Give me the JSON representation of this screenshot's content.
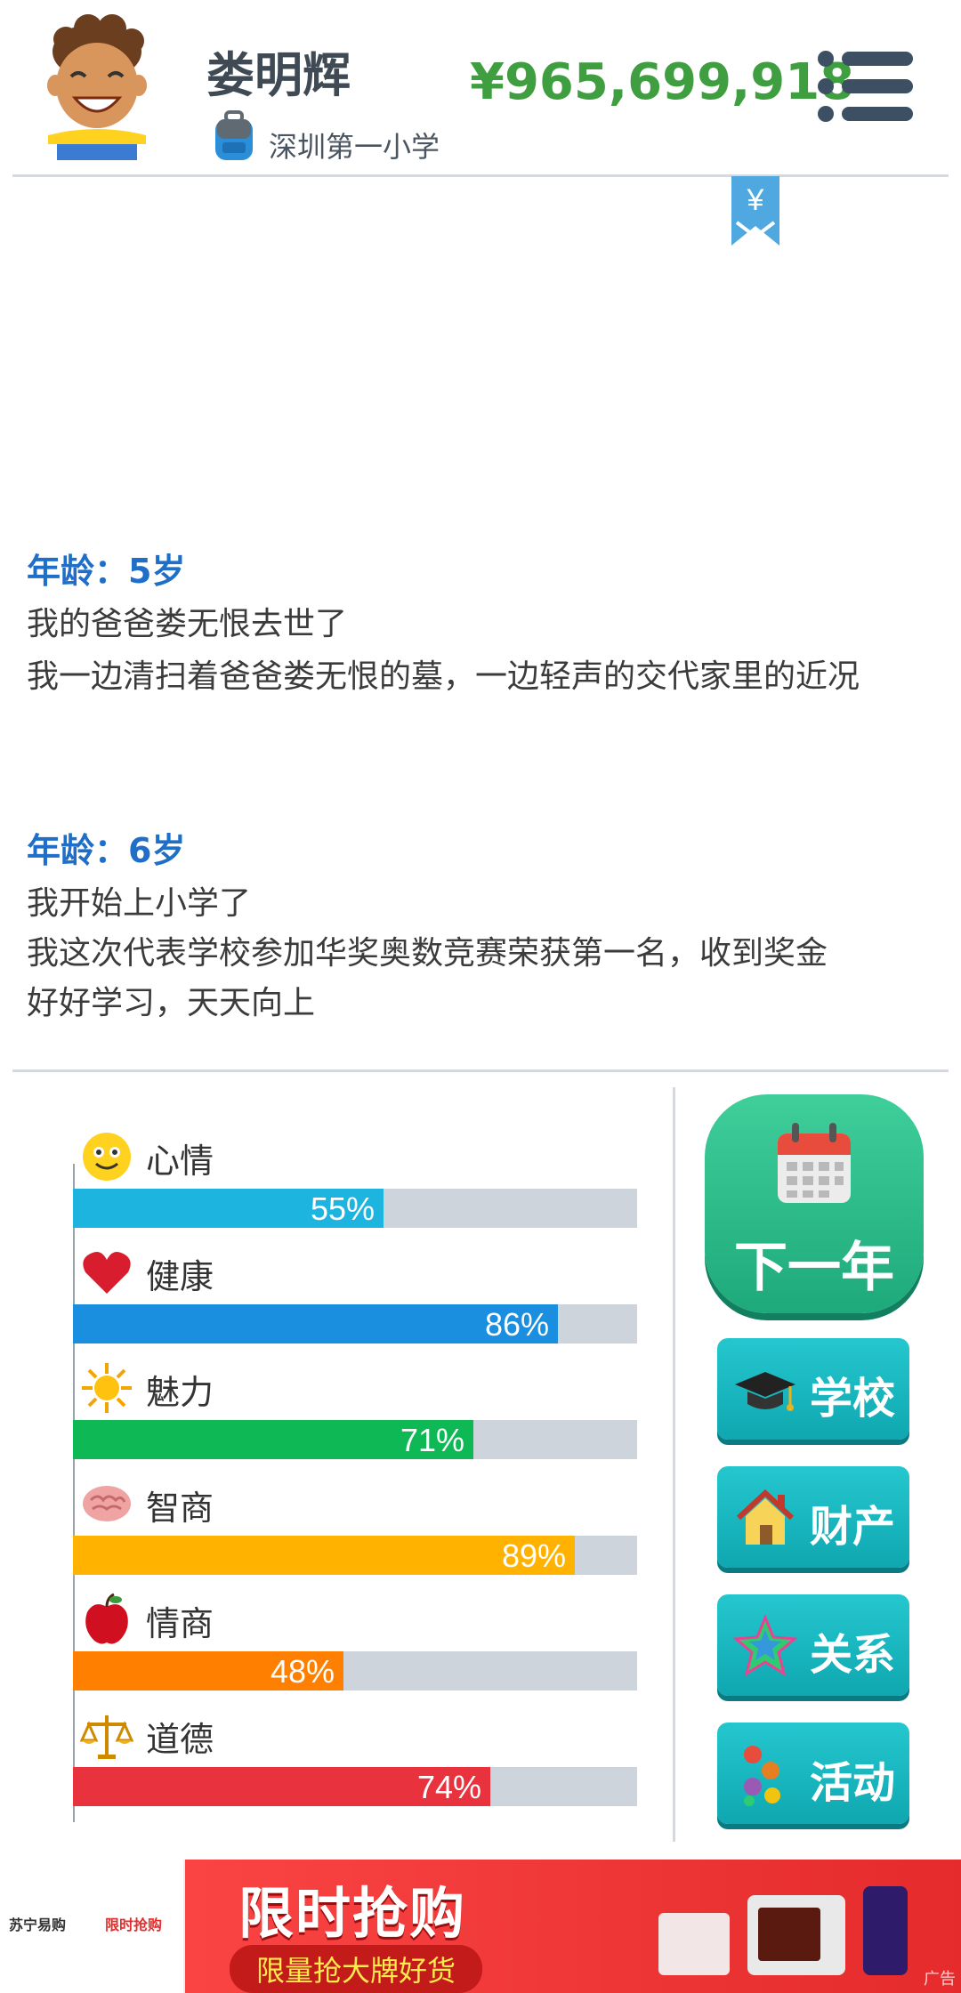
{
  "header": {
    "player_name": "娄明辉",
    "school": "深圳第一小学",
    "money": "¥965,699,918"
  },
  "bookmark": {
    "symbol": "¥"
  },
  "log": [
    {
      "age": "年龄：5岁",
      "lines": [
        "我的爸爸娄无恨去世了",
        "我一边清扫着爸爸娄无恨的墓，一边轻声的交代家里的近况"
      ]
    },
    {
      "age": "年龄：6岁",
      "lines": [
        "我开始上小学了",
        "我这次代表学校参加华奖奥数竞赛荣获第一名，收到奖金",
        "好好学习，天天向上"
      ]
    }
  ],
  "stats": [
    {
      "label": "心情",
      "pct": "55%",
      "value": 0.55,
      "color": "#1eb4e0",
      "icon": "smiley-icon"
    },
    {
      "label": "健康",
      "pct": "86%",
      "value": 0.86,
      "color": "#1a8fe0",
      "icon": "heart-icon"
    },
    {
      "label": "魅力",
      "pct": "71%",
      "value": 0.71,
      "color": "#0db855",
      "icon": "sun-icon"
    },
    {
      "label": "智商",
      "pct": "89%",
      "value": 0.89,
      "color": "#ffb300",
      "icon": "brain-icon"
    },
    {
      "label": "情商",
      "pct": "48%",
      "value": 0.48,
      "color": "#ff8000",
      "icon": "apple-icon"
    },
    {
      "label": "道德",
      "pct": "74%",
      "value": 0.74,
      "color": "#e8333e",
      "icon": "scales-icon"
    }
  ],
  "actions": {
    "next_year": "下一年",
    "school": "学校",
    "property": "财产",
    "relations": "关系",
    "activities": "活动"
  },
  "ad": {
    "brand": "苏宁易购",
    "brand_tag": "限时抢购",
    "title": "限时抢购",
    "subtitle": "限量抢大牌好货",
    "mark": "广告"
  }
}
